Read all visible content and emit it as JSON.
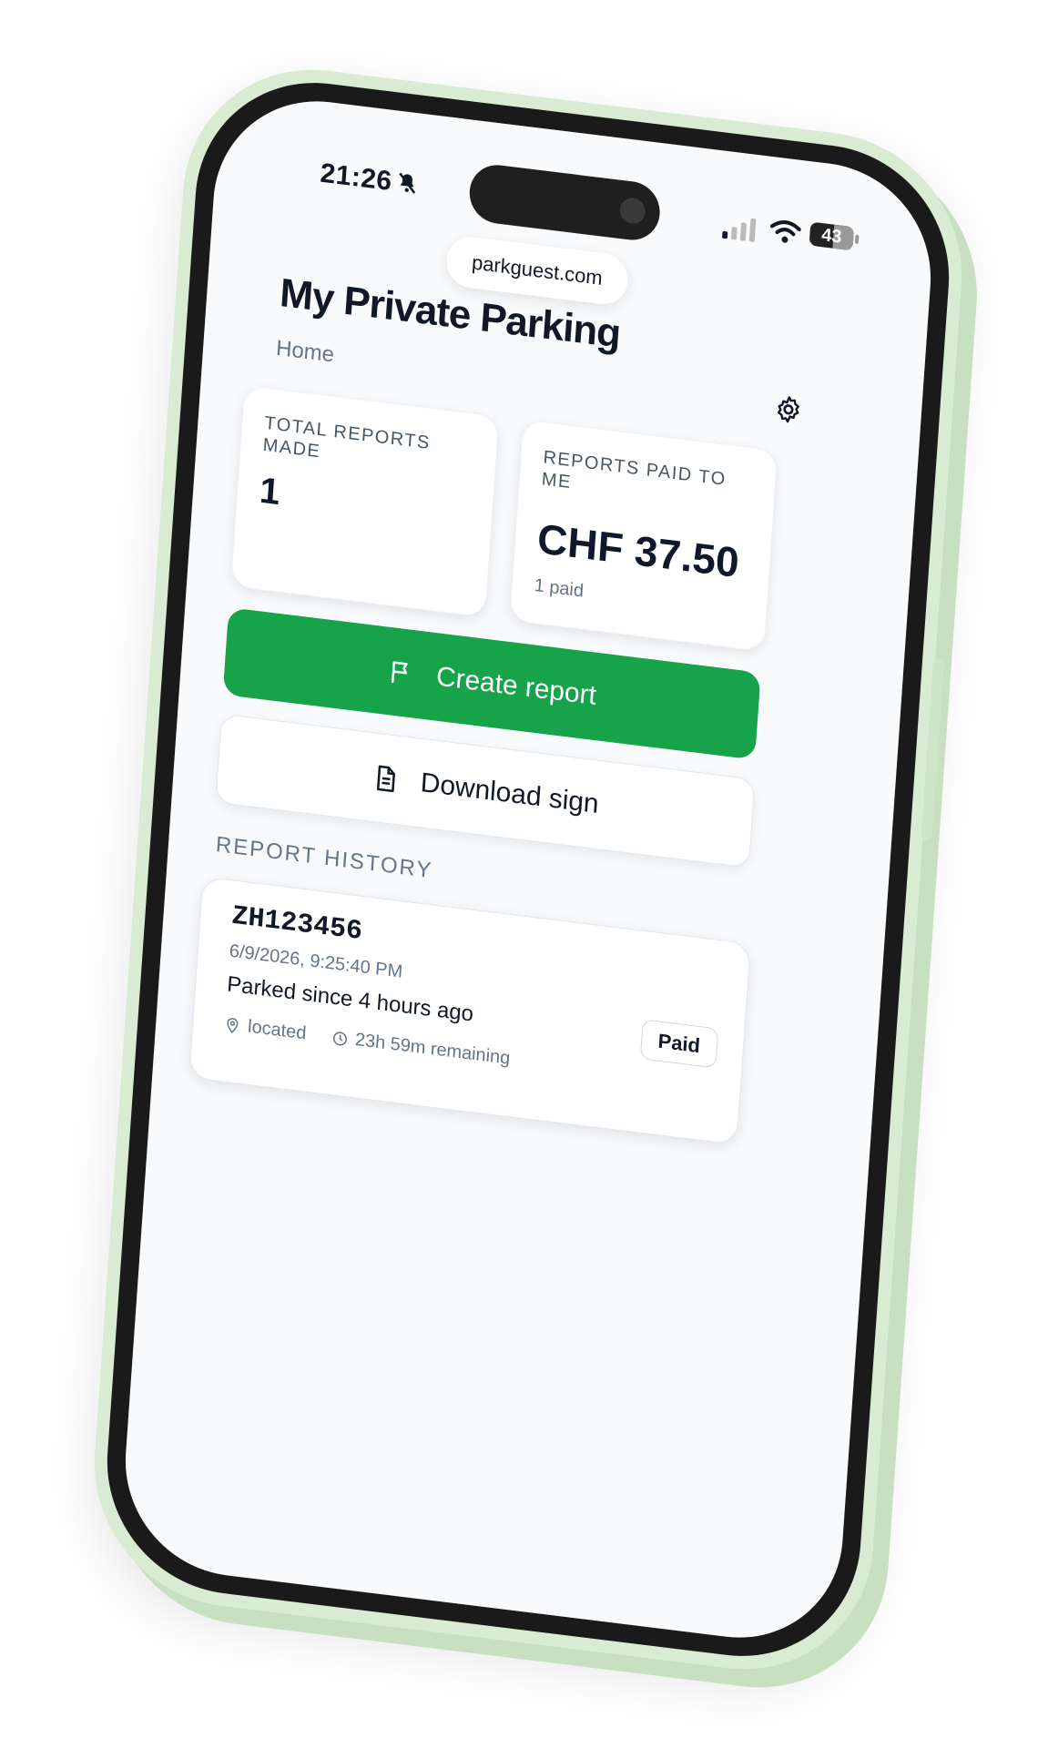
{
  "status_bar": {
    "time": "21:26",
    "battery": "43"
  },
  "browser": {
    "url": "parkguest.com"
  },
  "header": {
    "title": "My Private Parking",
    "breadcrumb": "Home"
  },
  "stats": {
    "total_reports": {
      "label": "TOTAL REPORTS MADE",
      "value": "1"
    },
    "reports_paid": {
      "label": "REPORTS PAID TO ME",
      "value": "CHF 37.50",
      "sub": "1 paid"
    }
  },
  "actions": {
    "create_report": "Create report",
    "download_sign": "Download sign"
  },
  "history": {
    "heading": "REPORT HISTORY",
    "reports": [
      {
        "plate": "ZH123456",
        "date": "6/9/2026, 9:25:40 PM",
        "parked_since": "Parked since 4 hours ago",
        "location": "located",
        "remaining": "23h 59m remaining",
        "status": "Paid"
      }
    ]
  },
  "colors": {
    "primary_green": "#16a34a",
    "phone_case": "#d9ecd3",
    "text_dark": "#111827",
    "text_muted": "#64748b"
  }
}
